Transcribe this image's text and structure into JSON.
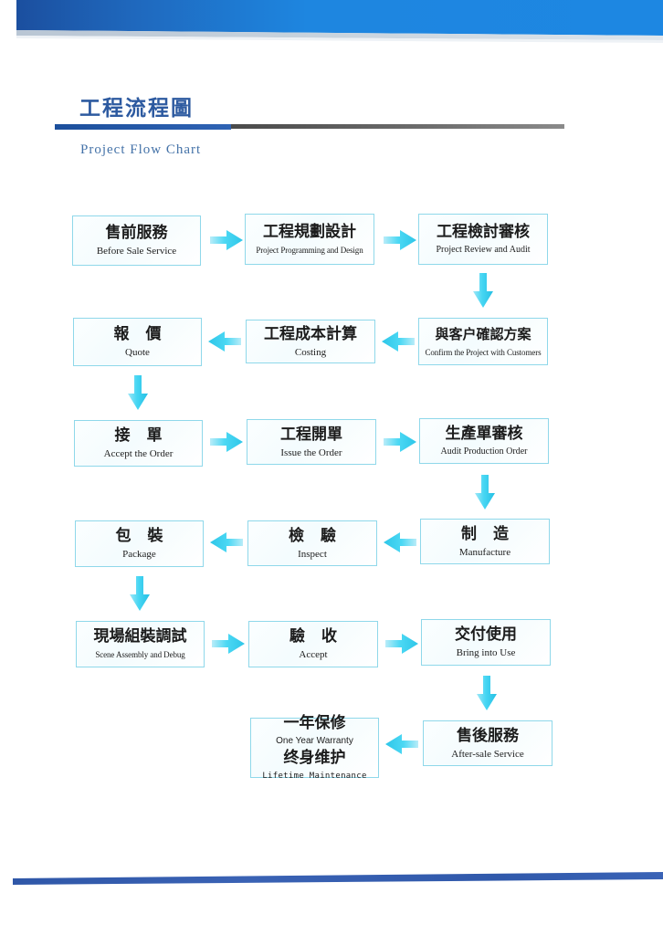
{
  "page": {
    "title_cn": "工程流程圖",
    "title_en": "Project Flow Chart",
    "accent_blue": "#2d5aa0",
    "band_blue_light": "#1e86e0",
    "band_blue_dark": "#1a4f9e",
    "node_border": "#8fd8ea",
    "arrow_cyan": "#35d4f2"
  },
  "flow": {
    "rows": [
      {
        "id": "row-1",
        "direction": "ltr",
        "nodes": [
          {
            "cn": "售前服務",
            "en": "Before Sale Service"
          },
          {
            "cn": "工程規劃設計",
            "en": "Project Programming and Design"
          },
          {
            "cn": "工程檢討審核",
            "en": "Project Review and Audit"
          }
        ]
      },
      {
        "id": "row-2",
        "direction": "rtl",
        "nodes": [
          {
            "cn": "報 價",
            "en": "Quote"
          },
          {
            "cn": "工程成本計算",
            "en": "Costing"
          },
          {
            "cn": "與客户確認方案",
            "en": "Confirm the Project with Customers"
          }
        ]
      },
      {
        "id": "row-3",
        "direction": "ltr",
        "nodes": [
          {
            "cn": "接 單",
            "en": "Accept the Order"
          },
          {
            "cn": "工程開單",
            "en": "Issue the Order"
          },
          {
            "cn": "生產單審核",
            "en": "Audit Production Order"
          }
        ]
      },
      {
        "id": "row-4",
        "direction": "rtl",
        "nodes": [
          {
            "cn": "包 裝",
            "en": "Package"
          },
          {
            "cn": "檢 驗",
            "en": "Inspect"
          },
          {
            "cn": "制 造",
            "en": "Manufacture"
          }
        ]
      },
      {
        "id": "row-5",
        "direction": "ltr",
        "nodes": [
          {
            "cn": "現場組裝調試",
            "en": "Scene Assembly and Debug"
          },
          {
            "cn": "驗 收",
            "en": "Accept"
          },
          {
            "cn": "交付使用",
            "en": "Bring into Use"
          }
        ]
      },
      {
        "id": "row-6",
        "direction": "rtl",
        "nodes": [
          {
            "cn": "一年保修",
            "en": "One Year Warranty",
            "cn2": "终身维护",
            "en2": "Lifetime Maintenance"
          },
          {
            "cn": "售後服務",
            "en": "After-sale Service"
          }
        ]
      }
    ],
    "connectors": [
      {
        "name": "arrow-r1-n1-to-n2",
        "type": "right"
      },
      {
        "name": "arrow-r1-n2-to-n3",
        "type": "right"
      },
      {
        "name": "arrow-r1-n3-down",
        "type": "down"
      },
      {
        "name": "arrow-r2-n3-to-n2",
        "type": "left"
      },
      {
        "name": "arrow-r2-n2-to-n1",
        "type": "left"
      },
      {
        "name": "arrow-r2-n1-down",
        "type": "down"
      },
      {
        "name": "arrow-r3-n1-to-n2",
        "type": "right"
      },
      {
        "name": "arrow-r3-n2-to-n3",
        "type": "right"
      },
      {
        "name": "arrow-r3-n3-down",
        "type": "down"
      },
      {
        "name": "arrow-r4-n3-to-n2",
        "type": "left"
      },
      {
        "name": "arrow-r4-n2-to-n1",
        "type": "left"
      },
      {
        "name": "arrow-r4-n1-down",
        "type": "down"
      },
      {
        "name": "arrow-r5-n1-to-n2",
        "type": "right"
      },
      {
        "name": "arrow-r5-n2-to-n3",
        "type": "right"
      },
      {
        "name": "arrow-r5-n3-down",
        "type": "down"
      },
      {
        "name": "arrow-r6-n2-to-n1",
        "type": "left"
      }
    ]
  }
}
